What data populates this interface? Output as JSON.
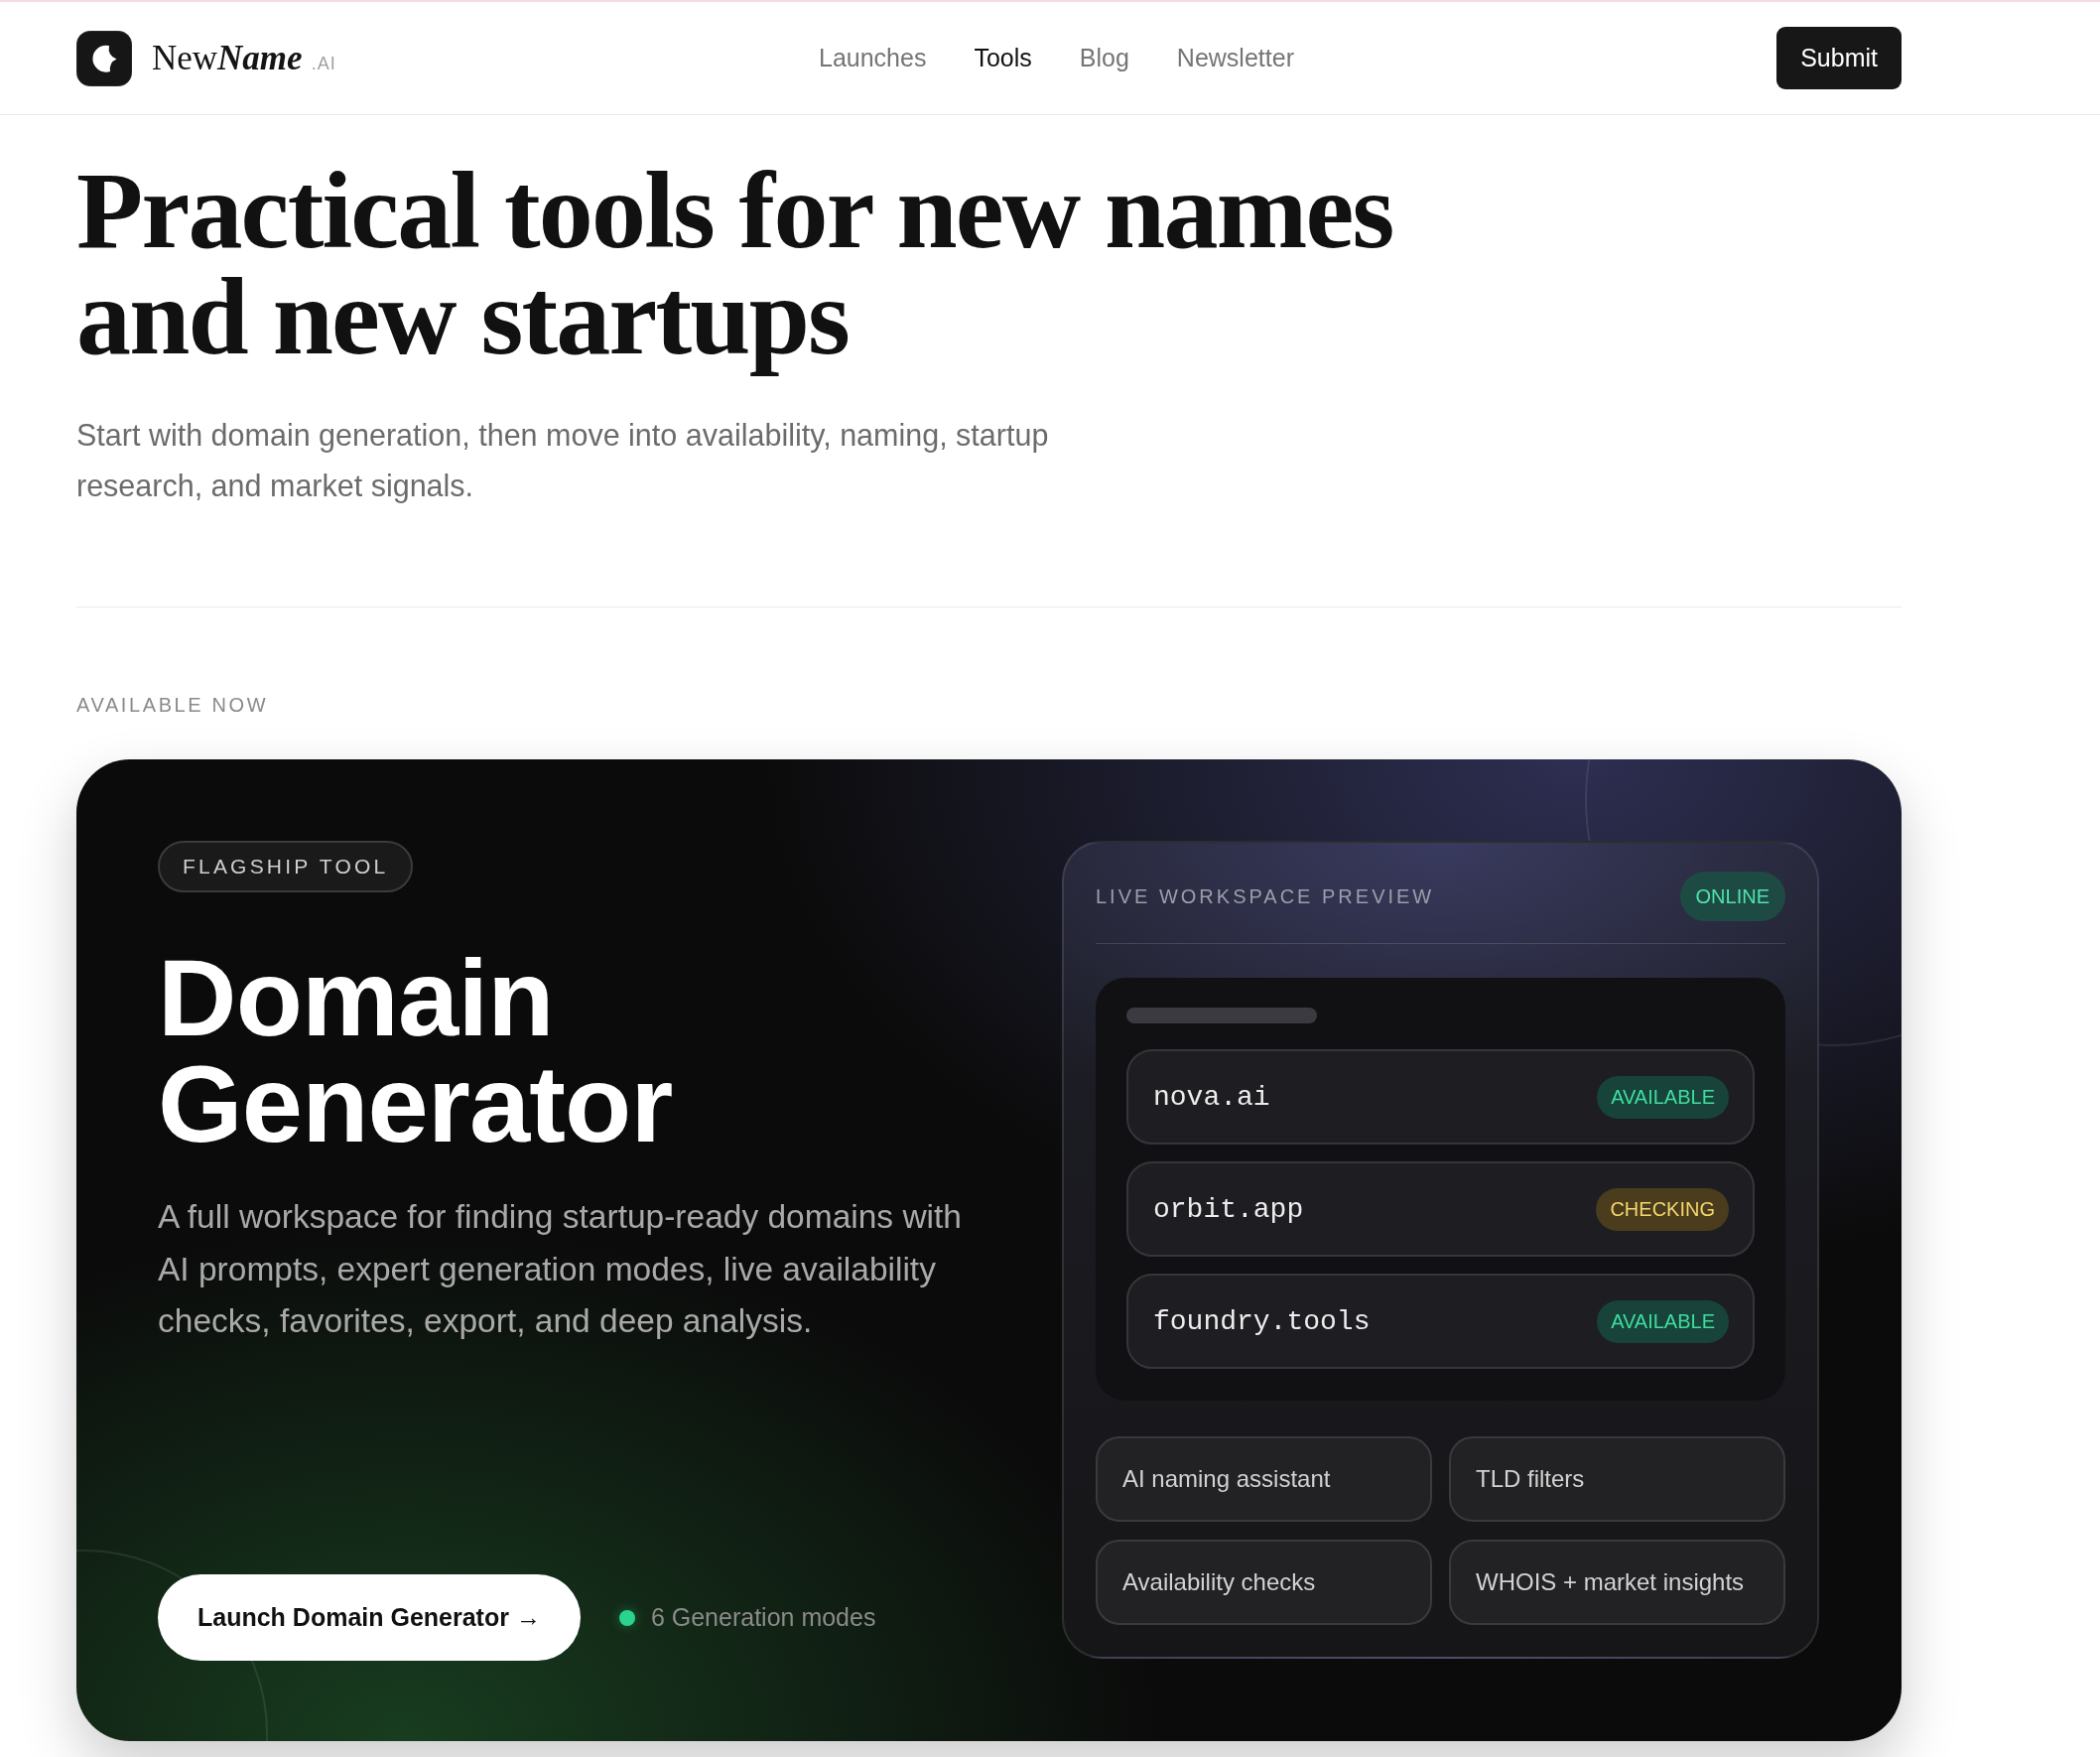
{
  "header": {
    "logo": {
      "wordmark": "New",
      "wordmark_emphasis": "Name",
      "suffix": ".AI"
    },
    "nav": [
      {
        "label": "Launches",
        "selected": false
      },
      {
        "label": "Tools",
        "selected": true
      },
      {
        "label": "Blog",
        "selected": false
      },
      {
        "label": "Newsletter",
        "selected": false
      }
    ],
    "submit_button": "Submit"
  },
  "hero": {
    "title": "Practical tools for new names and new startups",
    "subtitle": "Start with domain generation, then move into availability, naming, startup research, and market signals."
  },
  "section": {
    "label": "AVAILABLE NOW"
  },
  "feature_card": {
    "badge": "FLAGSHIP TOOL",
    "title": "Domain Generator",
    "description": "A full workspace for finding startup-ready domains with AI prompts, expert generation modes, live availability checks, favorites, export, and deep analysis.",
    "cta": "Launch Domain Generator →",
    "meta": {
      "color": "#2ad48c",
      "text": "6 Generation modes"
    },
    "preview": {
      "title": "LIVE WORKSPACE PREVIEW",
      "status": {
        "label": "ONLINE",
        "kind": "online"
      },
      "domains": [
        {
          "name": "nova.ai",
          "status": {
            "label": "AVAILABLE",
            "kind": "available"
          }
        },
        {
          "name": "orbit.app",
          "status": {
            "label": "CHECKING",
            "kind": "checking"
          }
        },
        {
          "name": "foundry.tools",
          "status": {
            "label": "AVAILABLE",
            "kind": "available"
          }
        }
      ],
      "features": [
        "AI naming assistant",
        "TLD filters",
        "Availability checks",
        "WHOIS + market insights"
      ]
    }
  }
}
